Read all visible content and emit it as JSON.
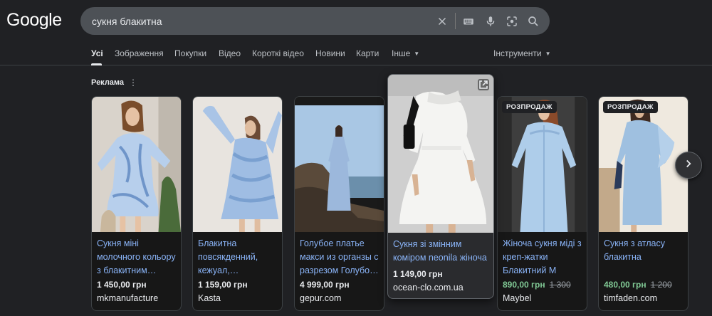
{
  "logo": "Google",
  "search": {
    "query": "сукня блакитна"
  },
  "tabs": [
    {
      "label": "Усі",
      "active": true
    },
    {
      "label": "Зображення"
    },
    {
      "label": "Покупки"
    },
    {
      "label": "Відео"
    },
    {
      "label": "Короткі відео"
    },
    {
      "label": "Новини"
    },
    {
      "label": "Карти"
    },
    {
      "label": "Інше"
    }
  ],
  "tools": "Інструменти",
  "ads": {
    "label": "Реклама",
    "products": [
      {
        "title": "Сукня міні молочного кольору з блакитним…",
        "price": "1 450,00 грн",
        "merchant": "mkmanufacture"
      },
      {
        "title": "Блакитна повсякденний, кежуал,…",
        "price": "1 159,00 грн",
        "merchant": "Kasta"
      },
      {
        "title": "Голубое платье макси из органзы с разрезом Голубо…",
        "price": "4 999,00 грн",
        "merchant": "gepur.com"
      },
      {
        "title": "Сукня зі змінним коміром neonila жіноча",
        "price": "1 149,00 грн",
        "merchant": "ocean-clo.com.ua"
      },
      {
        "badge": "РОЗПРОДАЖ",
        "title": "Жіноча сукня міді з креп-жатки Блакитний M",
        "price": "890,00 грн",
        "old_price": "1 300",
        "merchant": "Maybel"
      },
      {
        "badge": "РОЗПРОДАЖ",
        "title": "Сукня з атласу блакитна",
        "price": "480,00 грн",
        "old_price": "1 200",
        "merchant": "timfaden.com"
      }
    ]
  },
  "icons": {
    "clear": "close-icon",
    "keyboard": "keyboard-icon",
    "voice": "microphone-icon",
    "lens": "camera-lens-icon",
    "search": "search-icon",
    "menu": "more-vert-icon",
    "next": "chevron-right-icon",
    "open": "open-external-icon"
  },
  "colors": {
    "background": "#202124",
    "link": "#8ab4f8",
    "sale_price": "#81c995",
    "search_bar": "#4d5156"
  }
}
